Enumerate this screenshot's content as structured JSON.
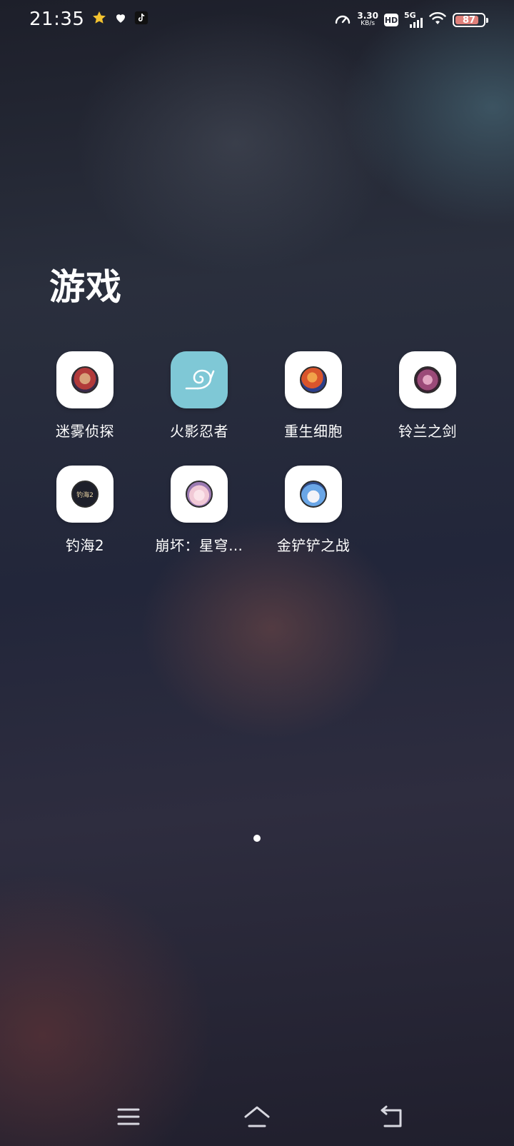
{
  "status_bar": {
    "time": "21:35",
    "notification_icons": [
      "star-icon",
      "heart-icon",
      "tiktok-icon"
    ],
    "net_speed_value": "3.30",
    "net_speed_unit": "KB/s",
    "hd_label": "HD",
    "network_label": "5G",
    "battery_percent": "87",
    "battery_level": 0.87
  },
  "folder": {
    "title": "游戏",
    "apps": [
      {
        "label": "迷雾侦探",
        "icon": "misty-detective-icon",
        "avatar_colors": [
          "#b23a3a",
          "#3b2a4a"
        ]
      },
      {
        "label": "火影忍者",
        "icon": "naruto-leaf-icon",
        "avatar_colors": [
          "#7fc8d6",
          "#ffffff"
        ]
      },
      {
        "label": "重生细胞",
        "icon": "dead-cells-icon",
        "avatar_colors": [
          "#d9552c",
          "#2c3f8a"
        ]
      },
      {
        "label": "铃兰之剑",
        "icon": "lily-sword-icon",
        "avatar_colors": [
          "#9b4a78",
          "#3b2232"
        ]
      },
      {
        "label": "钓海2",
        "icon": "fishing-sea-icon",
        "avatar_colors": [
          "#1d1f2a",
          "#c9a86a"
        ],
        "avatar_text": "钓海2"
      },
      {
        "label": "崩坏：星穹…",
        "icon": "star-rail-icon",
        "avatar_colors": [
          "#f1c9d6",
          "#9c7ab2"
        ]
      },
      {
        "label": "金铲铲之战",
        "icon": "golden-spatula-icon",
        "avatar_colors": [
          "#6aa6e6",
          "#f3f3f8"
        ]
      }
    ]
  },
  "nav_bar": {
    "items": [
      "menu-icon",
      "home-icon",
      "back-icon"
    ]
  },
  "colors": {
    "icon_background": "#ffffff",
    "teal_icon_background": "#7fc8d6",
    "text": "#ffffff"
  }
}
